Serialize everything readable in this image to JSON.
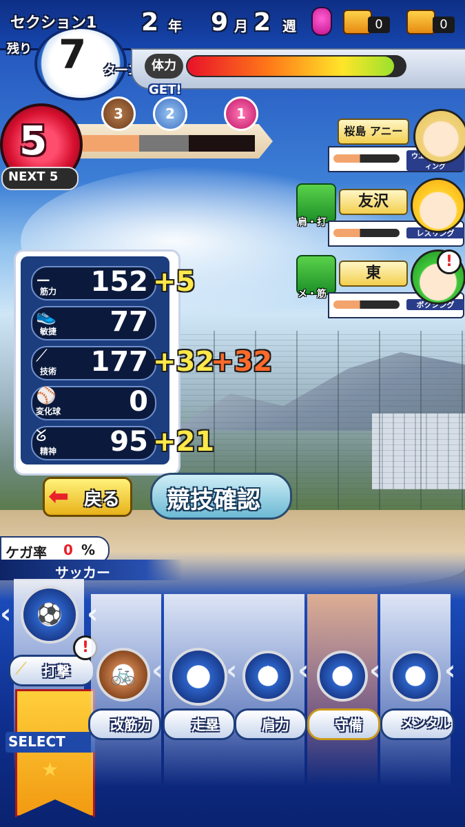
{
  "header": {
    "section": "セクション1",
    "remain": "残り",
    "turns": "7",
    "turn_unit": "ターン",
    "year": "2",
    "year_unit": "年",
    "month": "9",
    "month_unit": "月",
    "week": "2",
    "week_unit": "週",
    "chest1_count": "0",
    "chest2_count": "0"
  },
  "stamina": {
    "label": "体力",
    "level": 0.95
  },
  "level": {
    "value": "5",
    "next_label": "NEXT",
    "next_value": "5",
    "get_label": "GET!",
    "medals": [
      "3",
      "2",
      "1"
    ]
  },
  "characters": [
    {
      "name": "桜島 アニータ",
      "sport": "ウエイトリフティング",
      "tag": ""
    },
    {
      "name": "友沢",
      "sport": "レスリング",
      "tag": "肩・打"
    },
    {
      "name": "東",
      "sport": "ボクシング",
      "tag": "メ・筋",
      "alert": "!"
    }
  ],
  "stats": [
    {
      "label": "筋力",
      "value": "152",
      "bonus1": "+5",
      "bonus2": ""
    },
    {
      "label": "敏捷",
      "value": "77",
      "bonus1": "",
      "bonus2": ""
    },
    {
      "label": "技術",
      "value": "177",
      "bonus1": "+32",
      "bonus2": "+32"
    },
    {
      "label": "変化球",
      "value": "0",
      "bonus1": "",
      "bonus2": ""
    },
    {
      "label": "精神",
      "value": "95",
      "bonus1": "+21",
      "bonus2": ""
    }
  ],
  "buttons": {
    "back": "戻る",
    "check": "競技確認"
  },
  "injury": {
    "label": "ケガ率",
    "value": "0",
    "unit": "%"
  },
  "selected_sport": "サッカー",
  "training": [
    {
      "label": "打撃",
      "icon": "soccer-ball-icon"
    },
    {
      "label": "改筋力",
      "icon": "bicycle-icon"
    },
    {
      "label": "走塁",
      "icon": "constellation-icon"
    },
    {
      "label": "肩力",
      "icon": "shuttlecock-icon"
    },
    {
      "label": "守備",
      "icon": "rugby-ball-icon"
    },
    {
      "label": "メンタル",
      "icon": "fencing-icon"
    }
  ],
  "select_label": "SELECT"
}
